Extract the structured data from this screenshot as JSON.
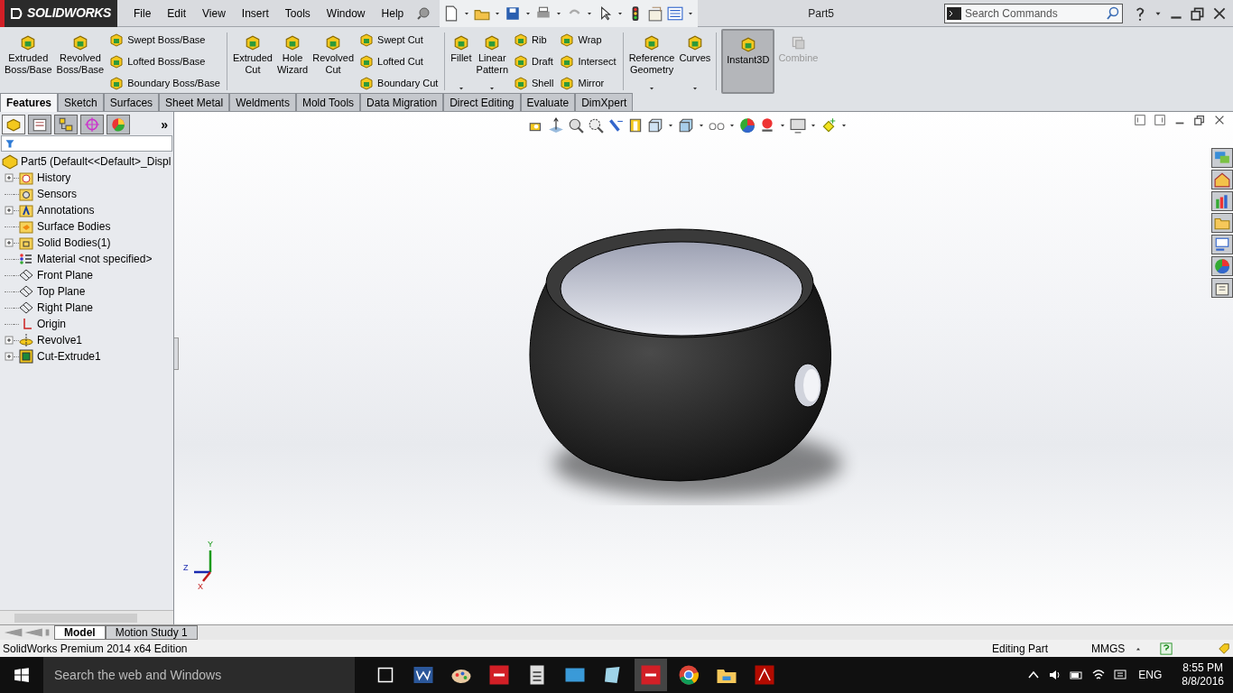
{
  "title_bar": {
    "logo_text": "SOLIDWORKS",
    "menus": [
      "File",
      "Edit",
      "View",
      "Insert",
      "Tools",
      "Window",
      "Help"
    ],
    "document_title": "Part5",
    "search": {
      "placeholder": "Search Commands"
    }
  },
  "ribbon_groups": [
    [
      {
        "kind": "large",
        "label": "Extruded\nBoss/Base",
        "dropdown": false,
        "selected": false,
        "disabled": false
      },
      {
        "kind": "large",
        "label": "Revolved\nBoss/Base",
        "dropdown": false,
        "selected": false,
        "disabled": false
      },
      {
        "kind": "stack",
        "items": [
          "Swept Boss/Base",
          "Lofted Boss/Base",
          "Boundary Boss/Base"
        ]
      }
    ],
    [
      {
        "kind": "large",
        "label": "Extruded\nCut",
        "dropdown": false,
        "selected": false,
        "disabled": false
      },
      {
        "kind": "large",
        "label": "Hole\nWizard",
        "dropdown": false,
        "selected": false,
        "disabled": false
      },
      {
        "kind": "large",
        "label": "Revolved\nCut",
        "dropdown": false,
        "selected": false,
        "disabled": false
      },
      {
        "kind": "stack",
        "items": [
          "Swept Cut",
          "Lofted Cut",
          "Boundary Cut"
        ]
      }
    ],
    [
      {
        "kind": "large",
        "label": "Fillet",
        "dropdown": true,
        "selected": false,
        "disabled": false
      },
      {
        "kind": "large",
        "label": "Linear\nPattern",
        "dropdown": true,
        "selected": false,
        "disabled": false
      },
      {
        "kind": "stack",
        "items": [
          "Rib",
          "Draft",
          "Shell"
        ]
      },
      {
        "kind": "stack",
        "items": [
          "Wrap",
          "Intersect",
          "Mirror"
        ]
      }
    ],
    [
      {
        "kind": "large",
        "label": "Reference\nGeometry",
        "dropdown": true,
        "selected": false,
        "disabled": false
      },
      {
        "kind": "large",
        "label": "Curves",
        "dropdown": true,
        "selected": false,
        "disabled": false
      }
    ],
    [
      {
        "kind": "large",
        "label": "Instant3D",
        "dropdown": false,
        "selected": true,
        "disabled": false
      },
      {
        "kind": "large",
        "label": "Combine",
        "dropdown": false,
        "selected": false,
        "disabled": true
      }
    ]
  ],
  "tabs": [
    {
      "label": "Features",
      "selected": true
    },
    {
      "label": "Sketch",
      "selected": false
    },
    {
      "label": "Surfaces",
      "selected": false
    },
    {
      "label": "Sheet Metal",
      "selected": false
    },
    {
      "label": "Weldments",
      "selected": false
    },
    {
      "label": "Mold Tools",
      "selected": false
    },
    {
      "label": "Data Migration",
      "selected": false
    },
    {
      "label": "Direct Editing",
      "selected": false
    },
    {
      "label": "Evaluate",
      "selected": false
    },
    {
      "label": "DimXpert",
      "selected": false
    }
  ],
  "panel_tabs_overflow": "»",
  "feature_tree": {
    "root": "Part5  (Default<<Default>_Displ",
    "items": [
      {
        "label": "History",
        "kind": "expandable"
      },
      {
        "label": "Sensors",
        "kind": "leaf"
      },
      {
        "label": "Annotations",
        "kind": "expandable"
      },
      {
        "label": "Surface Bodies",
        "kind": "leaf"
      },
      {
        "label": "Solid Bodies(1)",
        "kind": "expandable"
      },
      {
        "label": "Material <not specified>",
        "kind": "leaf"
      },
      {
        "label": "Front Plane",
        "kind": "leaf"
      },
      {
        "label": "Top Plane",
        "kind": "leaf"
      },
      {
        "label": "Right Plane",
        "kind": "leaf"
      },
      {
        "label": "Origin",
        "kind": "leaf"
      },
      {
        "label": "Revolve1",
        "kind": "expandable"
      },
      {
        "label": "Cut-Extrude1",
        "kind": "expandable"
      }
    ]
  },
  "triad": {
    "y": "Y",
    "z": "Z",
    "x": "X"
  },
  "bottom_tabs": [
    {
      "label": "Model",
      "selected": true
    },
    {
      "label": "Motion Study 1",
      "selected": false
    }
  ],
  "status_bar": {
    "edition": "SolidWorks Premium 2014 x64 Edition",
    "mode": "Editing Part",
    "units": "MMGS"
  },
  "taskbar": {
    "search": {
      "placeholder": "Search the web and Windows"
    },
    "language": "ENG",
    "time": "8:55 PM",
    "date": "8/8/2016"
  }
}
